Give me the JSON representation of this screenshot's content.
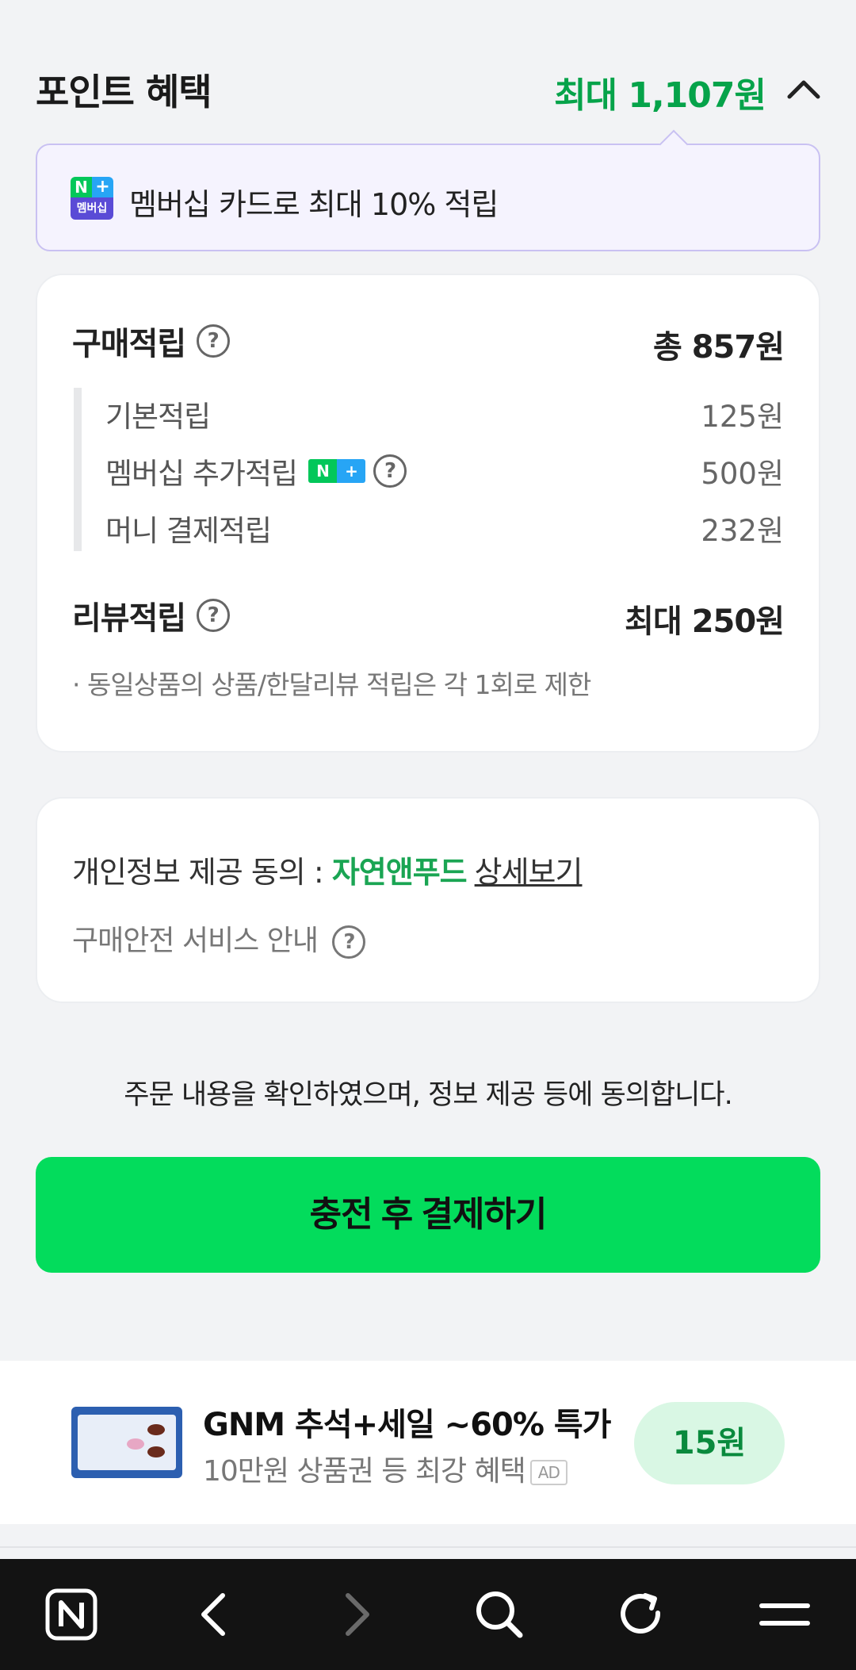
{
  "points": {
    "title": "포인트 혜택",
    "max": "최대 1,107원",
    "expand_icon": "chevron-up-icon",
    "membership_banner": {
      "badge_top_n": "N",
      "badge_top_plus": "+",
      "badge_bottom": "멤버십",
      "text": "멤버십 카드로 최대 10% 적립"
    }
  },
  "purchase_reward": {
    "label": "구매적립",
    "help_icon": "question-circle-icon",
    "total": "총 857원",
    "items": [
      {
        "label": "기본적립",
        "value": "125원"
      },
      {
        "label": "멤버십 추가적립",
        "value": "500원"
      },
      {
        "label": "머니 결제적립",
        "value": "232원"
      }
    ]
  },
  "review_reward": {
    "label": "리뷰적립",
    "value": "최대 250원",
    "note": "· 동일상품의 상품/한달리뷰 적립은 각 1회로 제한"
  },
  "consent": {
    "prefix": "개인정보 제공 동의 : ",
    "seller": "자연앤푸드",
    "detail_link": "상세보기",
    "safety": "구매안전 서비스 안내"
  },
  "agree_text": "주문 내용을 확인하였으며, 정보 제공 등에 동의합니다.",
  "pay_button": "충전 후 결제하기",
  "ad": {
    "title": "GNM 추석+세일 ~60% 특가",
    "subtitle": "10만원 상품권 등 최강 혜택",
    "tag": "AD",
    "price": "15원"
  },
  "nav": {
    "items": [
      "naver-home-icon",
      "back-icon",
      "forward-icon",
      "search-icon",
      "refresh-icon",
      "menu-icon"
    ]
  },
  "colors": {
    "accent_green": "#06a34a",
    "button_green": "#03dc5c",
    "banner_purple": "#c9c1f2"
  }
}
